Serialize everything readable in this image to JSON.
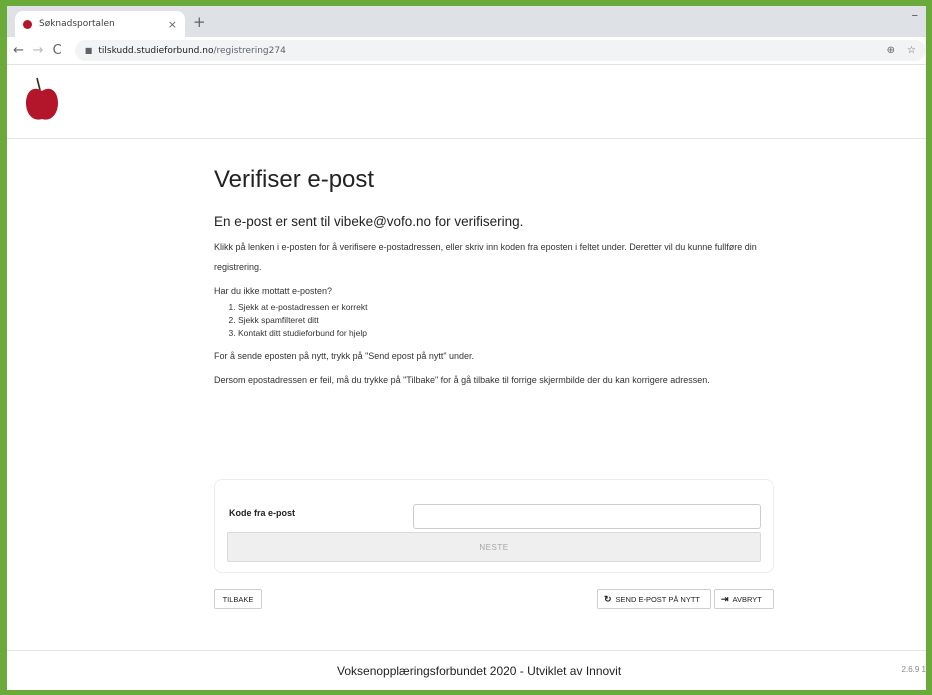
{
  "browser": {
    "tab_title": "Søknadsportalen",
    "tab_close": "×",
    "new_tab": "+",
    "window_minimize": "–",
    "url_host": "tilskudd.studieforbund.no",
    "url_path": "/registrering274",
    "zoom_icon": "⊕",
    "bookmark_icon": "☆"
  },
  "page": {
    "title": "Verifiser e-post",
    "subtitle": "En e-post er sent til vibeke@vofo.no for verifisering.",
    "paragraph1": "Klikk på lenken i e-posten for å verifisere e-postadressen, eller skriv inn koden fra eposten i feltet under. Deretter vil du kunne fullføre din registrering.",
    "paragraph2": "Har du ikke mottatt e-posten?",
    "steps": [
      "Sjekk at e-postadressen er korrekt",
      "Sjekk spamfilteret ditt",
      "Kontakt ditt studieforbund for hjelp"
    ],
    "paragraph3": "For å sende eposten på nytt, trykk på \"Send epost på nytt\" under.",
    "paragraph4": "Dersom epostadressen er feil, må du trykke på \"Tilbake\" for å gå tilbake til forrige skjermbilde der du kan korrigere adressen."
  },
  "form": {
    "code_label": "Kode fra e-post",
    "code_value": "",
    "next_label": "NESTE"
  },
  "actions": {
    "back_label": "TILBAKE",
    "resend_label": "SEND E-POST PÅ NYTT",
    "cancel_label": "AVBRYT"
  },
  "footer": {
    "text": "Voksenopplæringsforbundet 2020 - Utviklet av Innovit",
    "version": "2.6.9 1"
  },
  "colors": {
    "frame_border": "#6aaa3a",
    "apple_red": "#b3152a"
  }
}
